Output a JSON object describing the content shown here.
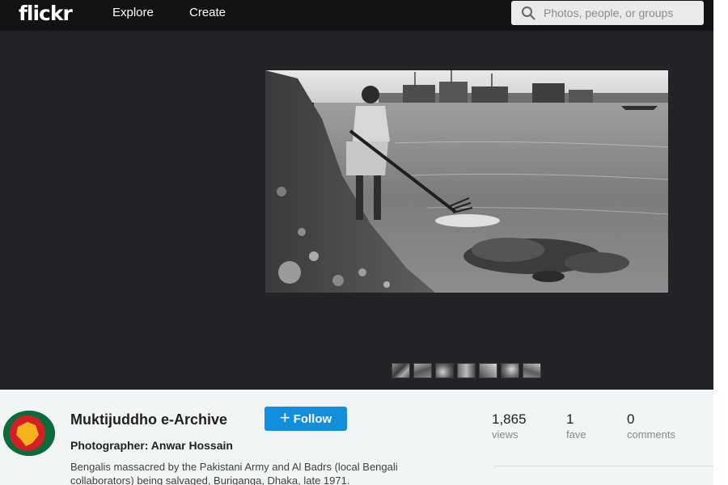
{
  "app": {
    "logo": "flickr"
  },
  "nav": {
    "explore": "Explore",
    "create": "Create"
  },
  "search": {
    "placeholder": "Photos, people, or groups",
    "icon": "search-icon"
  },
  "photo": {
    "alt": "Black and white photograph of a man with a long pole standing in a river near bodies, boats in the background",
    "filmstrip_count": 7
  },
  "owner": {
    "name": "Muktijuddho e-Archive"
  },
  "follow_button": {
    "icon": "plus-icon",
    "label": "Follow"
  },
  "details": {
    "title": "Photographer: Anwar Hossain",
    "description": "Bengalis massacred by the Pakistani Army and Al Badrs (local Bengali collaborators) being salvaged, Buriganga, Dhaka, late 1971."
  },
  "stats": {
    "views": {
      "value": "1,865",
      "label": "views"
    },
    "faves": {
      "value": "1",
      "label": "fave"
    },
    "comments": {
      "value": "0",
      "label": "comments"
    }
  },
  "colors": {
    "topbar": "#121214",
    "stage": "#222227",
    "info_panel": "#f2f5f6",
    "follow_blue": "#128fdc",
    "avatar_green": "#0a6b3b",
    "avatar_red": "#d32027",
    "avatar_yellow": "#f5b21b"
  }
}
